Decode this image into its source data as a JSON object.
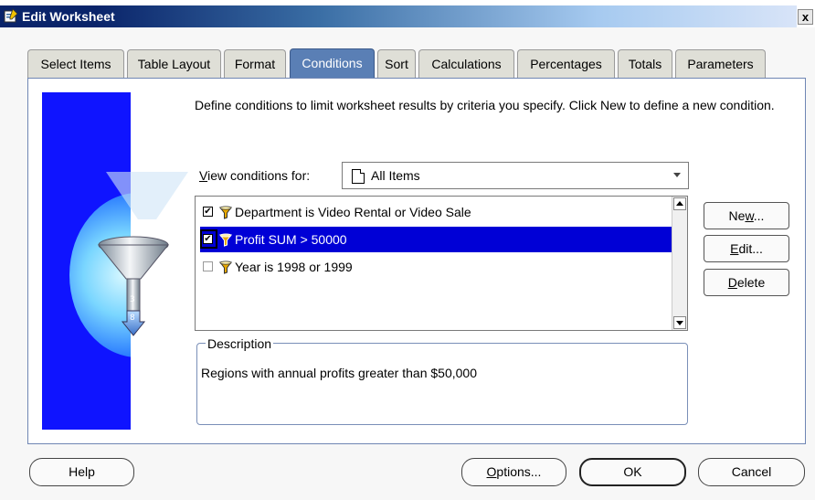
{
  "window": {
    "title": "Edit Worksheet",
    "close_glyph": "x"
  },
  "tabs": [
    {
      "label": "Select Items",
      "active": false
    },
    {
      "label": "Table Layout",
      "active": false
    },
    {
      "label": "Format",
      "active": false
    },
    {
      "label": "Conditions",
      "active": true
    },
    {
      "label": "Sort",
      "active": false
    },
    {
      "label": "Calculations",
      "active": false
    },
    {
      "label": "Percentages",
      "active": false
    },
    {
      "label": "Totals",
      "active": false
    },
    {
      "label": "Parameters",
      "active": false
    }
  ],
  "instructions": "Define conditions to limit worksheet results by criteria you specify. Click New to define a new condition.",
  "view_conditions": {
    "label": "View conditions for:",
    "mnemonic": "V",
    "label_rest": "iew conditions for:",
    "value": "All Items",
    "icon": "document-icon"
  },
  "conditions": [
    {
      "label": "Department is Video Rental or Video Sale",
      "checked": true,
      "selected": false,
      "icon": "funnel-icon"
    },
    {
      "label": "Profit SUM > 50000",
      "checked": true,
      "selected": true,
      "icon": "funnel-icon"
    },
    {
      "label": "Year is 1998 or 1999",
      "checked": false,
      "selected": false,
      "icon": "funnel-icon"
    }
  ],
  "description": {
    "legend": "Description",
    "text": "Regions with annual profits greater than $50,000"
  },
  "side_buttons": {
    "new": {
      "label": "New...",
      "pre": "Ne",
      "mn": "w",
      "post": "..."
    },
    "edit": {
      "label": "Edit...",
      "pre": "",
      "mn": "E",
      "post": "dit..."
    },
    "delete": {
      "label": "Delete",
      "pre": "",
      "mn": "D",
      "post": "elete"
    }
  },
  "bottom_buttons": {
    "help": "Help",
    "options": {
      "label": "Options...",
      "mn": "O",
      "post": "ptions..."
    },
    "ok": "OK",
    "cancel": "Cancel"
  },
  "colors": {
    "active_tab": "#5a7fb5",
    "selection": "#0000d6",
    "illustration_bg": "#0f14ff"
  }
}
